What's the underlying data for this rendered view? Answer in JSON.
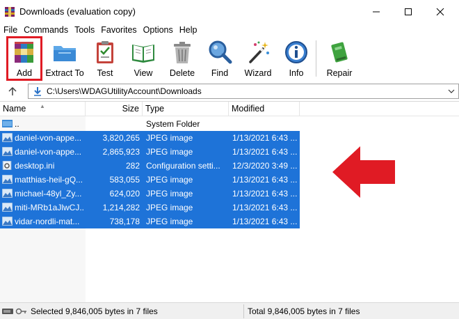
{
  "window": {
    "title": "Downloads (evaluation copy)"
  },
  "menu": [
    "File",
    "Commands",
    "Tools",
    "Favorites",
    "Options",
    "Help"
  ],
  "toolbar": {
    "add": "Add",
    "extract_to": "Extract To",
    "test": "Test",
    "view": "View",
    "delete": "Delete",
    "find": "Find",
    "wizard": "Wizard",
    "info": "Info",
    "repair": "Repair"
  },
  "address": {
    "path": "C:\\Users\\WDAGUtilityAccount\\Downloads"
  },
  "columns": {
    "name": "Name",
    "size": "Size",
    "type": "Type",
    "modified": "Modified"
  },
  "rows": [
    {
      "name": "..",
      "size": "",
      "type": "System Folder",
      "modified": "",
      "selected": false,
      "icon": "folder-up-icon"
    },
    {
      "name": "daniel-von-appe...",
      "size": "3,820,265",
      "type": "JPEG image",
      "modified": "1/13/2021 6:43 ...",
      "selected": true,
      "icon": "image-file-icon"
    },
    {
      "name": "daniel-von-appe...",
      "size": "2,865,923",
      "type": "JPEG image",
      "modified": "1/13/2021 6:43 ...",
      "selected": true,
      "icon": "image-file-icon"
    },
    {
      "name": "desktop.ini",
      "size": "282",
      "type": "Configuration setti...",
      "modified": "12/3/2020 3:49 ...",
      "selected": true,
      "icon": "settings-file-icon"
    },
    {
      "name": "matthias-heil-gQ...",
      "size": "583,055",
      "type": "JPEG image",
      "modified": "1/13/2021 6:43 ...",
      "selected": true,
      "icon": "image-file-icon"
    },
    {
      "name": "michael-48yl_Zy...",
      "size": "624,020",
      "type": "JPEG image",
      "modified": "1/13/2021 6:43 ...",
      "selected": true,
      "icon": "image-file-icon"
    },
    {
      "name": "miti-MRb1aJlwCJ...",
      "size": "1,214,282",
      "type": "JPEG image",
      "modified": "1/13/2021 6:43 ...",
      "selected": true,
      "icon": "image-file-icon"
    },
    {
      "name": "vidar-nordli-mat...",
      "size": "738,178",
      "type": "JPEG image",
      "modified": "1/13/2021 6:43 ...",
      "selected": true,
      "icon": "image-file-icon"
    }
  ],
  "status": {
    "selected": "Selected 9,846,005 bytes in 7 files",
    "total": "Total 9,846,005 bytes in 7 files"
  },
  "colors": {
    "selection": "#1e73d8",
    "highlight": "#e01b24"
  }
}
